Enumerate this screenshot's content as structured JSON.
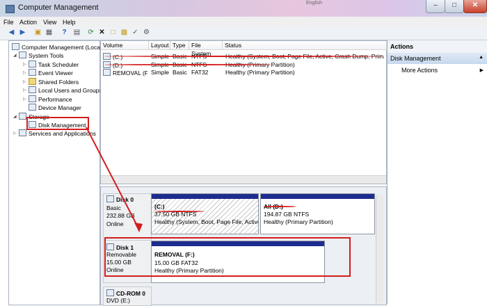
{
  "window": {
    "title": "Computer Management",
    "tray_text": "English"
  },
  "menu": [
    "File",
    "Action",
    "View",
    "Help"
  ],
  "tree": [
    {
      "label": "Computer Management (Local"
    },
    {
      "label": "System Tools"
    },
    {
      "label": "Task Scheduler"
    },
    {
      "label": "Event Viewer"
    },
    {
      "label": "Shared Folders"
    },
    {
      "label": "Local Users and Groups"
    },
    {
      "label": "Performance"
    },
    {
      "label": "Device Manager"
    },
    {
      "label": "Storage"
    },
    {
      "label": "Disk Management"
    },
    {
      "label": "Services and Applications"
    }
  ],
  "volumes": {
    "columns": [
      "Volume",
      "Layout",
      "Type",
      "File System",
      "Status"
    ],
    "rows": [
      {
        "volume": "(C:)",
        "layout": "Simple",
        "type": "Basic",
        "fs": "NTFS",
        "status": "Healthy (System, Boot, Page File, Active, Crash Dump, Primary"
      },
      {
        "volume": "(D:)",
        "layout": "Simple",
        "type": "Basic",
        "fs": "NTFS",
        "status": "Healthy (Primary Partition)"
      },
      {
        "volume": "REMOVAL (F:)",
        "layout": "Simple",
        "type": "Basic",
        "fs": "FAT32",
        "status": "Healthy (Primary Partition)"
      }
    ]
  },
  "disks": [
    {
      "name": "Disk 0",
      "type": "Basic",
      "size": "232.88 GB",
      "state": "Online",
      "partitions": [
        {
          "title": "(C:)",
          "size": "37.50 GB NTFS",
          "status": "Healthy (System, Boot, Page File, Active,"
        },
        {
          "title": "All (D:)",
          "size": "194.87 GB NTFS",
          "status": "Healthy (Primary Partition)"
        }
      ]
    },
    {
      "name": "Disk 1",
      "type": "Removable",
      "size": "15.00 GB",
      "state": "Online",
      "partitions": [
        {
          "title": "REMOVAL  (F:)",
          "size": "15.00 GB FAT32",
          "status": "Healthy (Primary Partition)"
        }
      ]
    },
    {
      "name": "CD-ROM 0",
      "type": "DVD (E:)"
    }
  ],
  "actions": {
    "header": "Actions",
    "selected": "Disk Management",
    "more": "More Actions"
  },
  "colors": {
    "partition_bar": "#1d2c8f",
    "annotation": "#d41c1c",
    "selection": "#c7d8ee"
  }
}
